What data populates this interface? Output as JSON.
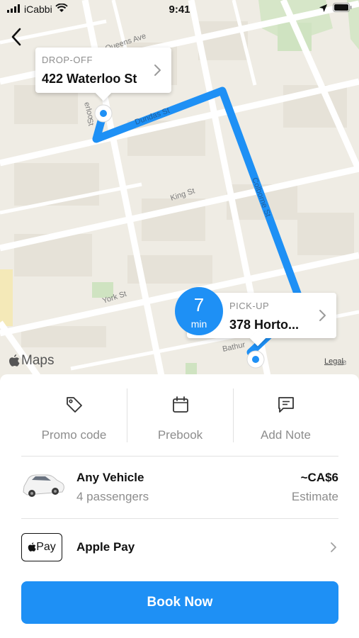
{
  "status_bar": {
    "carrier": "iCabbi",
    "time": "9:41"
  },
  "map": {
    "streets": {
      "queens_ave": "Queens Ave",
      "dundas_st": "Dundas St",
      "waterloo": "erloo",
      "waterloo_st": "St",
      "king_st": "King St",
      "colborne_st": "Colborne St",
      "york_st": "York St",
      "bathurst": "Bathur",
      "edge": "e"
    },
    "dropoff": {
      "label": "DROP-OFF",
      "address": "422 Waterloo St"
    },
    "pickup": {
      "label": "PICK-UP",
      "address": "378 Horto...",
      "eta_value": "7",
      "eta_unit": "min"
    },
    "attribution": "Maps",
    "legal": "Legal",
    "route_color": "#1e90f5"
  },
  "actions": [
    {
      "label": "Promo code",
      "icon": "tag-icon"
    },
    {
      "label": "Prebook",
      "icon": "calendar-icon"
    },
    {
      "label": "Add Note",
      "icon": "message-icon"
    }
  ],
  "vehicle": {
    "title": "Any Vehicle",
    "passengers": "4 passengers",
    "price": "~CA$6",
    "price_note": "Estimate"
  },
  "payment": {
    "badge": "Pay",
    "label": "Apple Pay"
  },
  "book_button": "Book Now",
  "colors": {
    "accent": "#1e90f5",
    "map_bg": "#efece4"
  }
}
